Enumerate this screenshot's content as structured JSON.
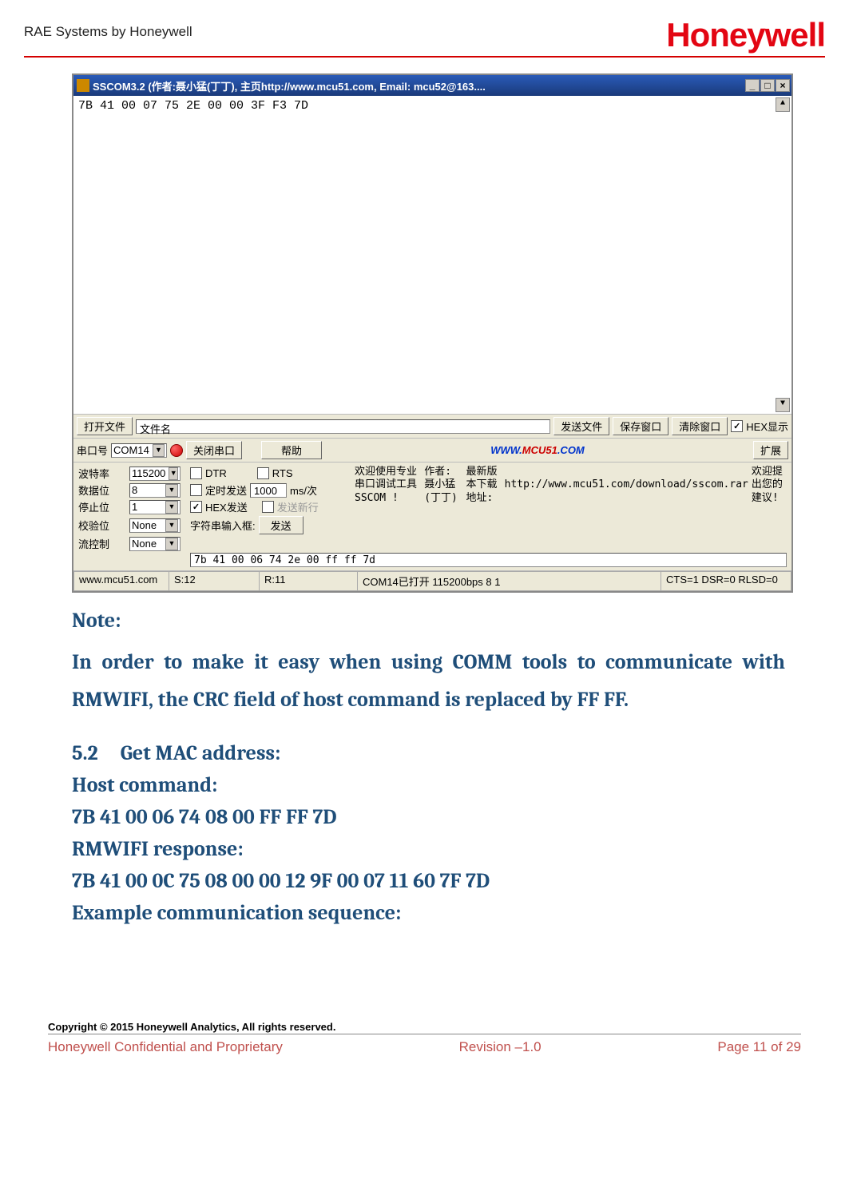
{
  "header": {
    "company": "RAE Systems by Honeywell",
    "logo": "Honeywell"
  },
  "sscom": {
    "title": "SSCOM3.2 (作者:聂小猛(丁丁), 主页http://www.mcu51.com,  Email: mcu52@163....",
    "console_text": "7B 41 00 07 75 2E 00 00 3F F3 7D",
    "row1": {
      "open_file": "打开文件",
      "filename": "文件名",
      "send_file": "发送文件",
      "save_window": "保存窗口",
      "clear_window": "清除窗口",
      "hex_display": "HEX显示"
    },
    "row2": {
      "port_no_lbl": "串口号",
      "port_value": "COM14",
      "close_port": "关闭串口",
      "help": "帮助",
      "url_www": "WWW.",
      "url_mcu": "MCU51",
      "url_com": ".COM",
      "expand": "扩展"
    },
    "settings": {
      "baud_lbl": "波特率",
      "baud_val": "115200",
      "data_lbl": "数据位",
      "data_val": "8",
      "stop_lbl": "停止位",
      "stop_val": "1",
      "parity_lbl": "校验位",
      "parity_val": "None",
      "flow_lbl": "流控制",
      "flow_val": "None",
      "dtr": "DTR",
      "rts": "RTS",
      "timed_send": "定时发送",
      "interval_val": "1000",
      "interval_unit": "ms/次",
      "hex_send": "HEX发送",
      "send_newline": "发送新行",
      "string_input_lbl": "字符串输入框:",
      "send_btn": "发送",
      "hex_value": "7b 41 00 06 74 2e 00 ff ff 7d"
    },
    "info": {
      "l1": "欢迎使用专业串口调试工具SSCOM !",
      "l2": "作者: 聂小猛(丁丁)",
      "l3": "最新版本下载地址:",
      "l4": "http://www.mcu51.com/download/sscom.rar",
      "l5": "欢迎提出您的建议!"
    },
    "status": {
      "site": "www.mcu51.com",
      "s": "S:12",
      "r": "R:11",
      "com": "COM14已打开  115200bps  8 1",
      "cts": "CTS=1 DSR=0 RLSD=0"
    }
  },
  "doc": {
    "note_head": "Note:",
    "note_body": "In order to make it easy when using COMM tools to communicate with RMWIFI, the CRC field of host command is replaced by FF FF.",
    "sec_num": "5.2",
    "sec_title": "Get MAC address:",
    "host_cmd_lbl": "Host command:",
    "host_cmd_val": "7B 41 00 06 74 08 00 FF FF 7D",
    "resp_lbl": "RMWIFI response:",
    "resp_val": "7B 41 00 0C 75 08 00 00 12 9F 00 07 11 60 7F 7D",
    "example_lbl": "Example communication sequence:"
  },
  "footer": {
    "copyright": "Copyright © 2015 Honeywell Analytics, All rights reserved.",
    "left": "Honeywell Confidential and Proprietary",
    "mid": "Revision –1.0",
    "right": "Page 11 of 29"
  }
}
